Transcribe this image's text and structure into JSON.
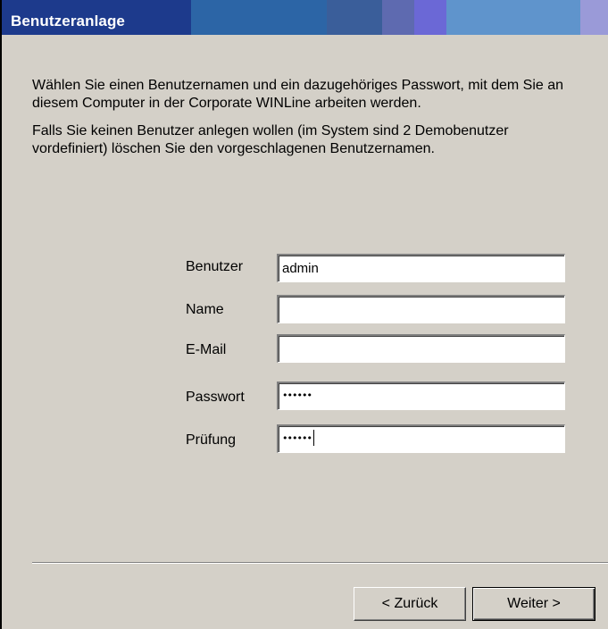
{
  "window": {
    "title": "Benutzeranlage"
  },
  "intro": {
    "para1": "Wählen Sie einen Benutzernamen und ein dazugehöriges Passwort, mit dem Sie an",
    "para1_line2": "diesem Computer in der Corporate WINLine arbeiten werden.",
    "para2": "Falls Sie keinen Benutzer anlegen wollen (im System sind 2 Demobenutzer",
    "para2_line2": "vordefiniert) löschen Sie den vorgeschlagenen Benutzernamen."
  },
  "form": {
    "user_label": "Benutzer",
    "user_value": "admin",
    "name_label": "Name",
    "name_value": "",
    "email_label": "E-Mail",
    "email_value": "",
    "password_label": "Passwort",
    "password_value": "••••••",
    "confirm_label": "Prüfung",
    "confirm_value": "••••••"
  },
  "buttons": {
    "back": "< Zurück",
    "next": "Weiter >"
  },
  "colors": {
    "title_dark": "#1b3a8a",
    "title_mid": "#2a66a8",
    "title_light": "#6a9ad0",
    "title_purple": "#6464d8",
    "dialog_bg": "#d4d0c8"
  }
}
